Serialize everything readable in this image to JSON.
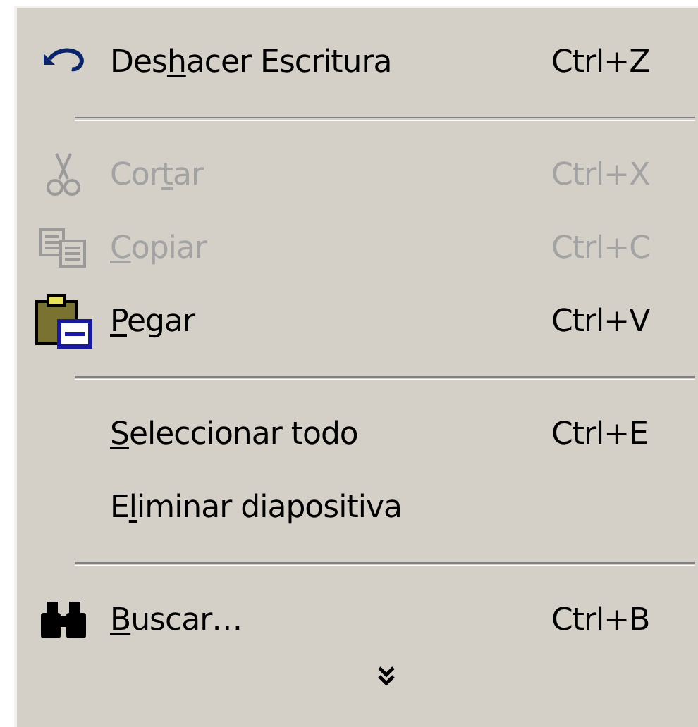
{
  "menu": {
    "items": [
      {
        "kind": "item",
        "before": "Des",
        "key": "h",
        "after": "acer Escritura",
        "shortcut": "Ctrl+Z",
        "disabled": false
      },
      {
        "kind": "separator"
      },
      {
        "kind": "item",
        "before": "Cor",
        "key": "t",
        "after": "ar",
        "shortcut": "Ctrl+X",
        "disabled": true
      },
      {
        "kind": "item",
        "key": "C",
        "after": "opiar",
        "shortcut": "Ctrl+C",
        "disabled": true
      },
      {
        "kind": "item",
        "key": "P",
        "after": "egar",
        "shortcut": "Ctrl+V",
        "disabled": false
      },
      {
        "kind": "separator"
      },
      {
        "kind": "item",
        "key": "S",
        "after": "eleccionar todo",
        "shortcut": "Ctrl+E",
        "disabled": false
      },
      {
        "kind": "item",
        "before": "E",
        "key": "l",
        "after": "iminar diapositiva",
        "disabled": false
      },
      {
        "kind": "separator"
      },
      {
        "kind": "item",
        "key": "B",
        "after": "uscar…",
        "shortcut": "Ctrl+B",
        "disabled": false
      }
    ]
  }
}
